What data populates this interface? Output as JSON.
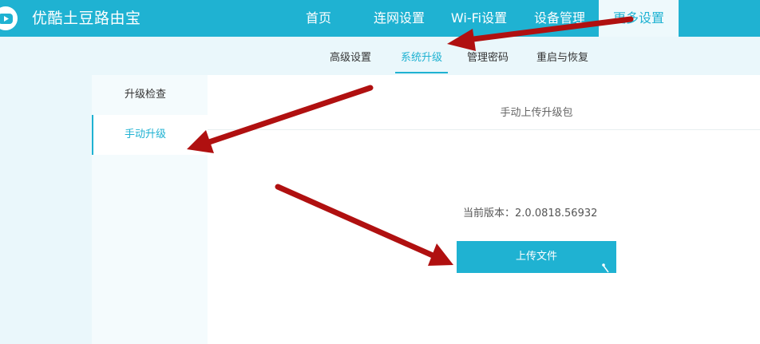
{
  "header": {
    "brand": "优酷土豆路由宝",
    "nav": [
      {
        "label": "首页"
      },
      {
        "label": "连网设置"
      },
      {
        "label": "Wi-Fi设置"
      },
      {
        "label": "设备管理"
      },
      {
        "label": "更多设置"
      }
    ]
  },
  "subnav": {
    "items": [
      {
        "label": "高级设置"
      },
      {
        "label": "系统升级"
      },
      {
        "label": "管理密码"
      },
      {
        "label": "重启与恢复"
      }
    ]
  },
  "sidebar": {
    "items": [
      {
        "label": "升级检查"
      },
      {
        "label": "手动升级"
      }
    ]
  },
  "main": {
    "title": "手动上传升级包",
    "version_label": "当前版本：",
    "version_value": "2.0.0818.56932",
    "upload_button": "上传文件"
  },
  "colors": {
    "accent": "#1fb2d2",
    "annotation_arrow": "#b01010"
  }
}
